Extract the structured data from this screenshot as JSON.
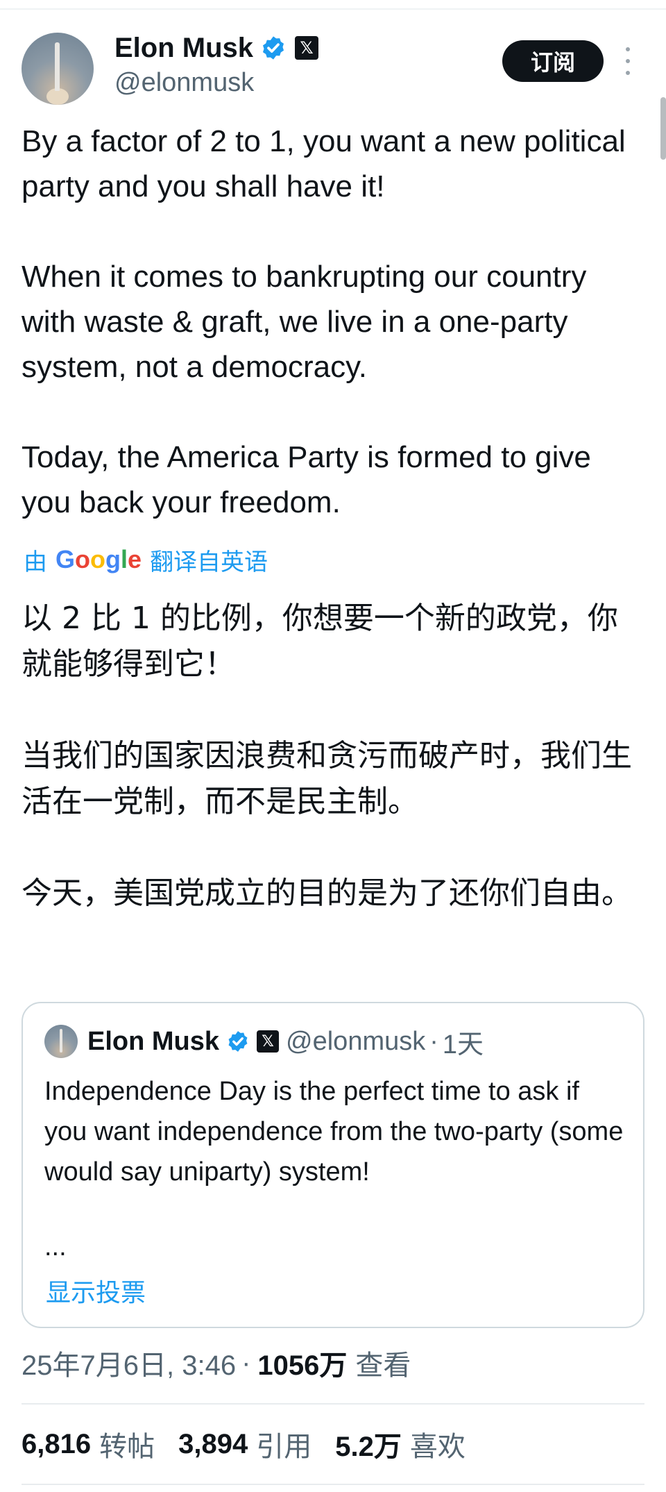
{
  "author": {
    "name": "Elon Musk",
    "handle": "@elonmusk",
    "x_badge_glyph": "𝕏"
  },
  "header": {
    "subscribe_label": "订阅"
  },
  "tweet": {
    "paragraphs": [
      "By a factor of 2 to 1, you want a new political party and you shall have it!",
      "When it comes to bankrupting our country with waste & graft, we live in a one-party system, not a democracy.",
      "Today, the America Party is formed to give you back your freedom."
    ]
  },
  "translation": {
    "prefix": "由",
    "provider": "Google",
    "suffix": "翻译自英语",
    "paragraphs": [
      "以 2 比 1 的比例，你想要一个新的政党，你就能够得到它！",
      "当我们的国家因浪费和贪污而破产时，我们生活在一党制，而不是民主制。",
      "今天，美国党成立的目的是为了还你们自由。"
    ]
  },
  "quote": {
    "name": "Elon Musk",
    "handle": "@elonmusk",
    "separator": "·",
    "time": "1天",
    "text": "Independence Day is the perfect time to ask if you want independence from the two-party (some would say uniparty) system!",
    "ellipsis": "...",
    "poll_link": "显示投票"
  },
  "meta": {
    "datetime": "25年7月6日, 3:46",
    "separator": "·",
    "views": "1056万",
    "views_label": "查看"
  },
  "stats": {
    "reposts": "6,816",
    "reposts_label": "转帖",
    "quotes": "3,894",
    "quotes_label": "引用",
    "likes": "5.2万",
    "likes_label": "喜欢"
  },
  "colors": {
    "link": "#1d9bf0",
    "secondary_text": "#536471",
    "primary_text": "#0f1419",
    "border": "#cfd9de"
  },
  "icons": [
    "verified-badge-icon",
    "x-logo-icon",
    "more-options-icon",
    "google-logo"
  ]
}
